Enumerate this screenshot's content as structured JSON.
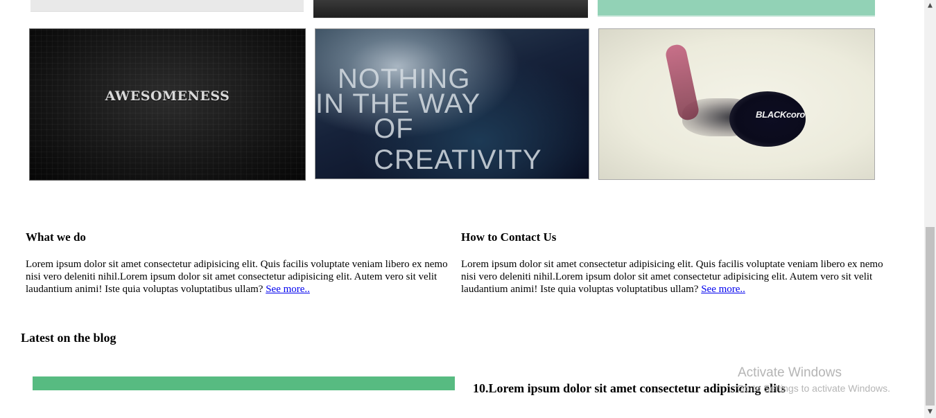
{
  "gallery": {
    "thumb1_text": "AWESOMENESS",
    "thumb2_lines": [
      "NOTHING",
      "IN THE WAY",
      "OF CREATIVITY"
    ],
    "thumb3_text": "BLACKcoro"
  },
  "sections": {
    "what": {
      "heading": "What we do",
      "body": "Lorem ipsum dolor sit amet consectetur adipisicing elit. Quis facilis voluptate veniam libero ex nemo nisi vero deleniti nihil.Lorem ipsum dolor sit amet consectetur adipisicing elit. Autem vero sit velit laudantium animi! Iste quia voluptas voluptatibus ullam?",
      "link": "See more.."
    },
    "contact": {
      "heading": "How to Contact Us",
      "body": "Lorem ipsum dolor sit amet consectetur adipisicing elit. Quis facilis voluptate veniam libero ex nemo nisi vero deleniti nihil.Lorem ipsum dolor sit amet consectetur adipisicing elit. Autem vero sit velit laudantium animi! Iste quia voluptas voluptatibus ullam?",
      "link": "See more.."
    }
  },
  "blog": {
    "heading": "Latest on the blog",
    "post_title": "10.Lorem ipsum dolor sit amet consectetur adipisicing elits",
    "bar_color": "#57bb81"
  },
  "watermark": {
    "title": "Activate Windows",
    "subtitle": "Go to Settings to activate Windows."
  },
  "scrollbar": {
    "up_icon": "▲",
    "down_icon": "▼"
  }
}
